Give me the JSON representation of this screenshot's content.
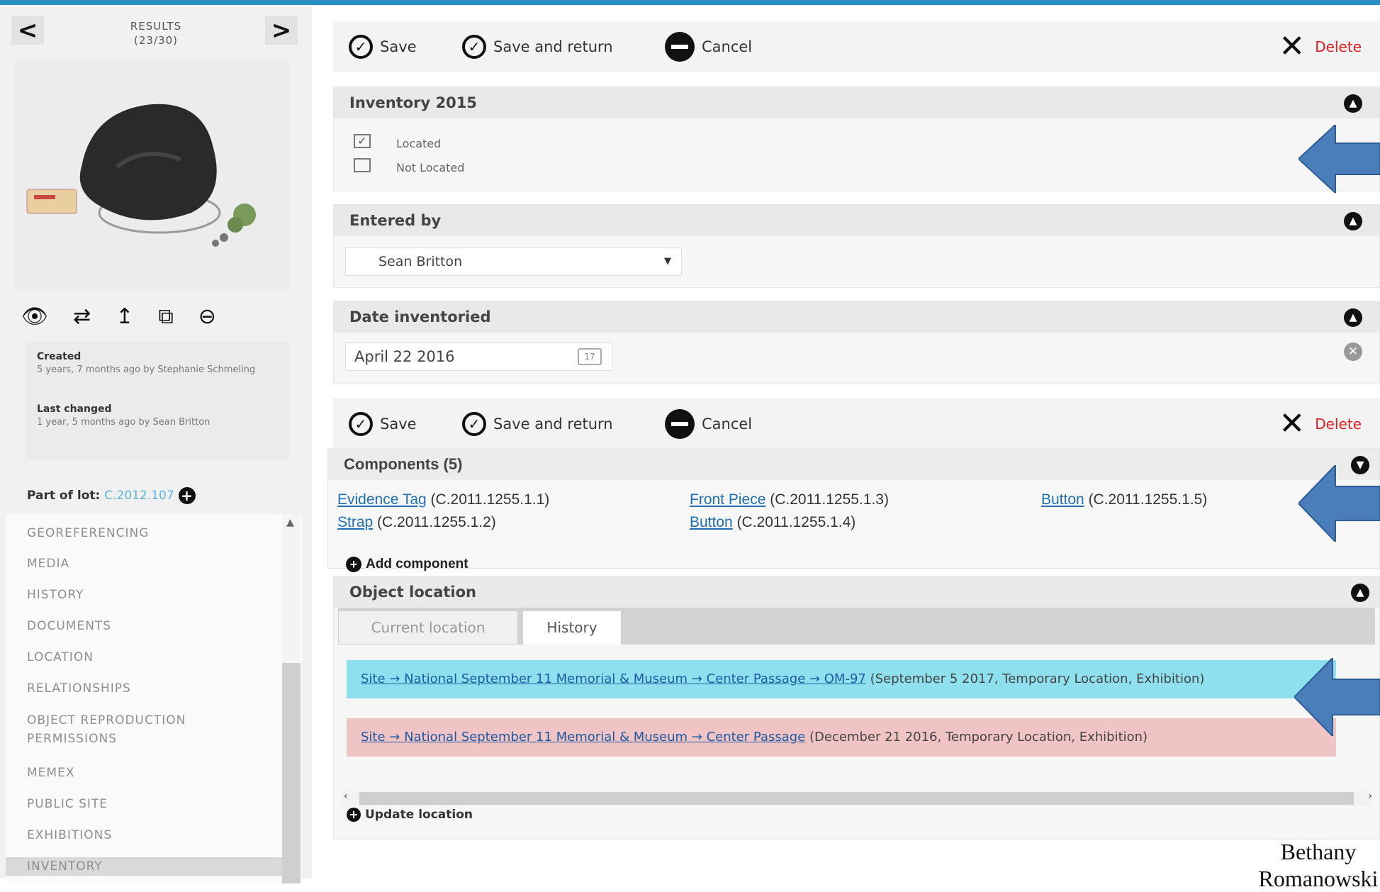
{
  "sidebar": {
    "prev_label": "<",
    "next_label": ">",
    "results_title": "RESULTS",
    "results_count": "(23/30)",
    "meta": {
      "created_label": "Created",
      "created_value": "5 years, 7 months ago by Stephanie Schmeling",
      "changed_label": "Last changed",
      "changed_value": "1 year, 5 months ago by Sean Britton"
    },
    "part_of_lot_label": "Part of lot:",
    "part_of_lot_value": "C.2012.107",
    "nav_items": [
      "GEOREFERENCING",
      "MEDIA",
      "HISTORY",
      "DOCUMENTS",
      "LOCATION",
      "RELATIONSHIPS",
      "OBJECT REPRODUCTION PERMISSIONS",
      "MEMEX",
      "PUBLIC SITE",
      "EXHIBITIONS",
      "INVENTORY"
    ],
    "active_nav": "INVENTORY"
  },
  "toolbar": {
    "save": "Save",
    "save_return": "Save and return",
    "cancel": "Cancel",
    "delete": "Delete"
  },
  "inventory": {
    "title": "Inventory 2015",
    "located": "Located",
    "not_located": "Not Located",
    "located_checked": true
  },
  "entered_by": {
    "title": "Entered by",
    "value": "Sean Britton"
  },
  "date_inventoried": {
    "title": "Date inventoried",
    "value": "April 22 2016"
  },
  "components": {
    "title": "Components (5)",
    "items": [
      {
        "name": "Evidence Tag",
        "id": "(C.2011.1255.1.1)"
      },
      {
        "name": "Strap",
        "id": "(C.2011.1255.1.2)"
      },
      {
        "name": "Front Piece",
        "id": "(C.2011.1255.1.3)"
      },
      {
        "name": "Button",
        "id": "(C.2011.1255.1.4)"
      },
      {
        "name": "Button",
        "id": "(C.2011.1255.1.5)"
      }
    ],
    "add_label": "Add component"
  },
  "object_location": {
    "title": "Object location",
    "tabs": [
      "Current location",
      "History"
    ],
    "active_tab": "History",
    "history": [
      {
        "path": "Site → National September 11 Memorial & Museum → Center Passage → OM-97",
        "details": "(September 5 2017, Temporary Location, Exhibition)"
      },
      {
        "path": "Site → National September 11 Memorial & Museum → Center Passage",
        "details": "(December 21 2016, Temporary Location, Exhibition)"
      }
    ],
    "update_label": "Update location"
  },
  "caption": {
    "line1": "Bethany",
    "line2": "Romanowski"
  },
  "colors": {
    "accent": "#2b8fc6",
    "delete": "#e02020",
    "history_current": "#8ee0ee",
    "history_past": "#f0c4c4",
    "annotation_arrow": "#4a7ebb"
  }
}
